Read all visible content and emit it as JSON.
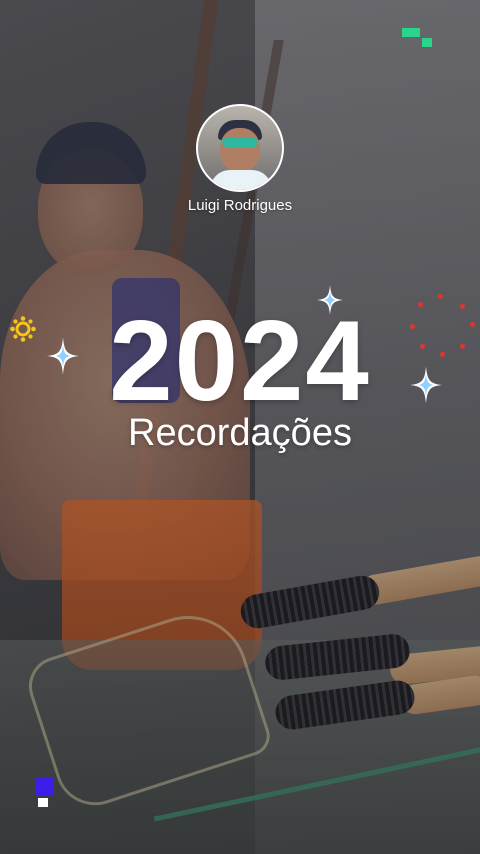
{
  "profile": {
    "name": "Luigi Rodrigues",
    "avatar_icon": "avatar-photo"
  },
  "title": {
    "year": "2024",
    "subtitle": "Recordações"
  },
  "decorations": {
    "accent_colors": [
      "#ffffff",
      "#f5c518",
      "#2ad48a",
      "#3b1ee8",
      "#e2342e",
      "#7fc4ff"
    ],
    "icons": [
      "sparkle-icon",
      "sun-icon",
      "pixel-block-icon",
      "dot-cluster-icon"
    ]
  }
}
